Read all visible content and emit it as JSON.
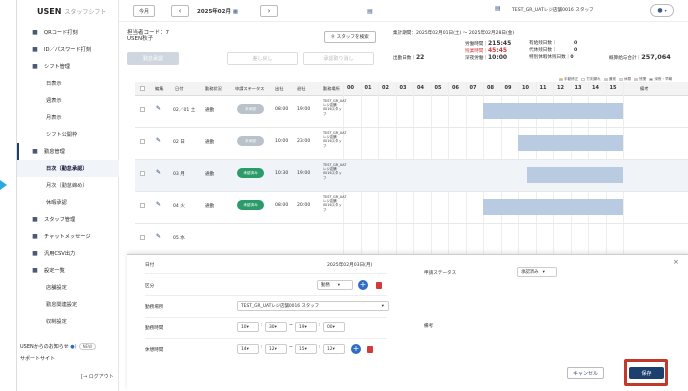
{
  "brand": {
    "logo": "USEN",
    "logo_sub": "スタッフシフト"
  },
  "sidebar": {
    "items": [
      {
        "label": "QRコード打刻",
        "icon": "qr-icon",
        "type": "main"
      },
      {
        "label": "ID／パスワード打刻",
        "icon": "user-key-icon",
        "type": "main"
      },
      {
        "label": "シフト管理",
        "icon": "calendar-icon",
        "type": "main"
      },
      {
        "label": "日表示",
        "type": "sub"
      },
      {
        "label": "週表示",
        "type": "sub"
      },
      {
        "label": "月表示",
        "type": "sub"
      },
      {
        "label": "シフト公開枠",
        "type": "sub"
      },
      {
        "label": "勤怠管理",
        "icon": "clock-icon",
        "type": "main-active"
      },
      {
        "label": "日次（勤怠承認）",
        "type": "sub-active"
      },
      {
        "label": "月次（勤怠締め）",
        "type": "sub"
      },
      {
        "label": "休暇承認",
        "type": "sub"
      },
      {
        "label": "スタッフ管理",
        "icon": "staff-icon",
        "type": "main"
      },
      {
        "label": "チャットメッセージ",
        "icon": "chat-icon",
        "type": "main"
      },
      {
        "label": "汎用CSV出力",
        "icon": "csv-icon",
        "type": "main"
      },
      {
        "label": "設定一覧",
        "icon": "gear-icon",
        "type": "main"
      },
      {
        "label": "店舗設定",
        "type": "sub"
      },
      {
        "label": "勤怠関連設定",
        "type": "sub"
      },
      {
        "label": "収制設定",
        "type": "sub"
      }
    ],
    "notice": "USENからのお知らせ",
    "notice_badge": "NEW",
    "support": "サポートサイト",
    "logout": "ログアウト"
  },
  "topbar": {
    "today": "今月",
    "month": "2025年02月",
    "shop": "TEST_GR_UATレジ店舗0016 スタッフ"
  },
  "header": {
    "empcode_label": "担当者コード：7",
    "emp_name": "USEN秋子",
    "search": "スタッフを検索",
    "btn_approve": "勤怠承認",
    "btn_return": "差し戻し",
    "btn_cancel_approve": "承認取り消し"
  },
  "summary": {
    "period": "集計期間：2025年02月01日(土) 〜 2025年02月28日(金)",
    "work_time_label": "労働時間",
    "work_time": "215:45",
    "over_time_label": "残業時間",
    "over_time": "45:45",
    "night_label": "深夜労働",
    "night": "10:00",
    "days_label": "出勤日数",
    "days": "22",
    "holiday_label": "有給残日数",
    "holiday": "0",
    "sub_label": "代休残日数",
    "sub": "0",
    "special_label": "特別休暇休残日数",
    "special": "0",
    "total_label": "概算給与合計",
    "total": "257,064",
    "legend": [
      "手動修正",
      "打刻漏れ",
      "通常",
      "休憩",
      "残業",
      "深夜・早朝"
    ]
  },
  "grid": {
    "headers": [
      "編集",
      "日付",
      "勤務状況",
      "申請ステータス",
      "出社",
      "退社",
      "勤務場所"
    ],
    "hours": [
      "00",
      "01",
      "02",
      "03",
      "04",
      "05",
      "06",
      "07",
      "08",
      "09",
      "10",
      "11",
      "12",
      "13",
      "14",
      "15"
    ],
    "memo": "備考",
    "rows": [
      {
        "date": "02／01 土",
        "kind": "通勤",
        "status": "未承認",
        "tin": "08:00",
        "tout": "19:00",
        "loc": "TEST_GR_UATレジ店舗0016スタッフ"
      },
      {
        "date": "02 日",
        "kind": "通勤",
        "status": "未承認",
        "tin": "10:00",
        "tout": "23:00",
        "loc": "TEST_GR_UATレジ店舗0016スタッフ"
      },
      {
        "date": "03 月",
        "kind": "通勤",
        "status": "承認済み",
        "tin": "10:30",
        "tout": "19:00",
        "loc": "TEST_GR_UATレジ店舗0016スタッフ"
      },
      {
        "date": "04 火",
        "kind": "通勤",
        "status": "承認済み",
        "tin": "08:00",
        "tout": "20:00",
        "loc": "TEST_GR_UATレジ店舗0016スタッフ"
      },
      {
        "date": "05 水",
        "kind": "",
        "status": "",
        "tin": "",
        "tout": "",
        "loc": ""
      }
    ]
  },
  "panel": {
    "date_label": "日付",
    "date_value": "2025年02月03日(月)",
    "kubun_label": "区分",
    "kubun_value": "勤務",
    "place_label": "勤務場所",
    "place_value": "TEST_GR_UATレジ店舗0016 スタッフ",
    "time_label": "勤務時間",
    "time_h1": "10",
    "time_m1": "30",
    "time_h2": "19",
    "time_m2": "00",
    "rest_label": "休憩時間",
    "rest_h1": "14",
    "rest_m1": "12",
    "rest_h2": "15",
    "rest_m2": "12",
    "status_label": "申請ステータス",
    "status_value": "承認済み",
    "memo_label": "備考",
    "cancel": "キャンセル",
    "save": "保存"
  }
}
